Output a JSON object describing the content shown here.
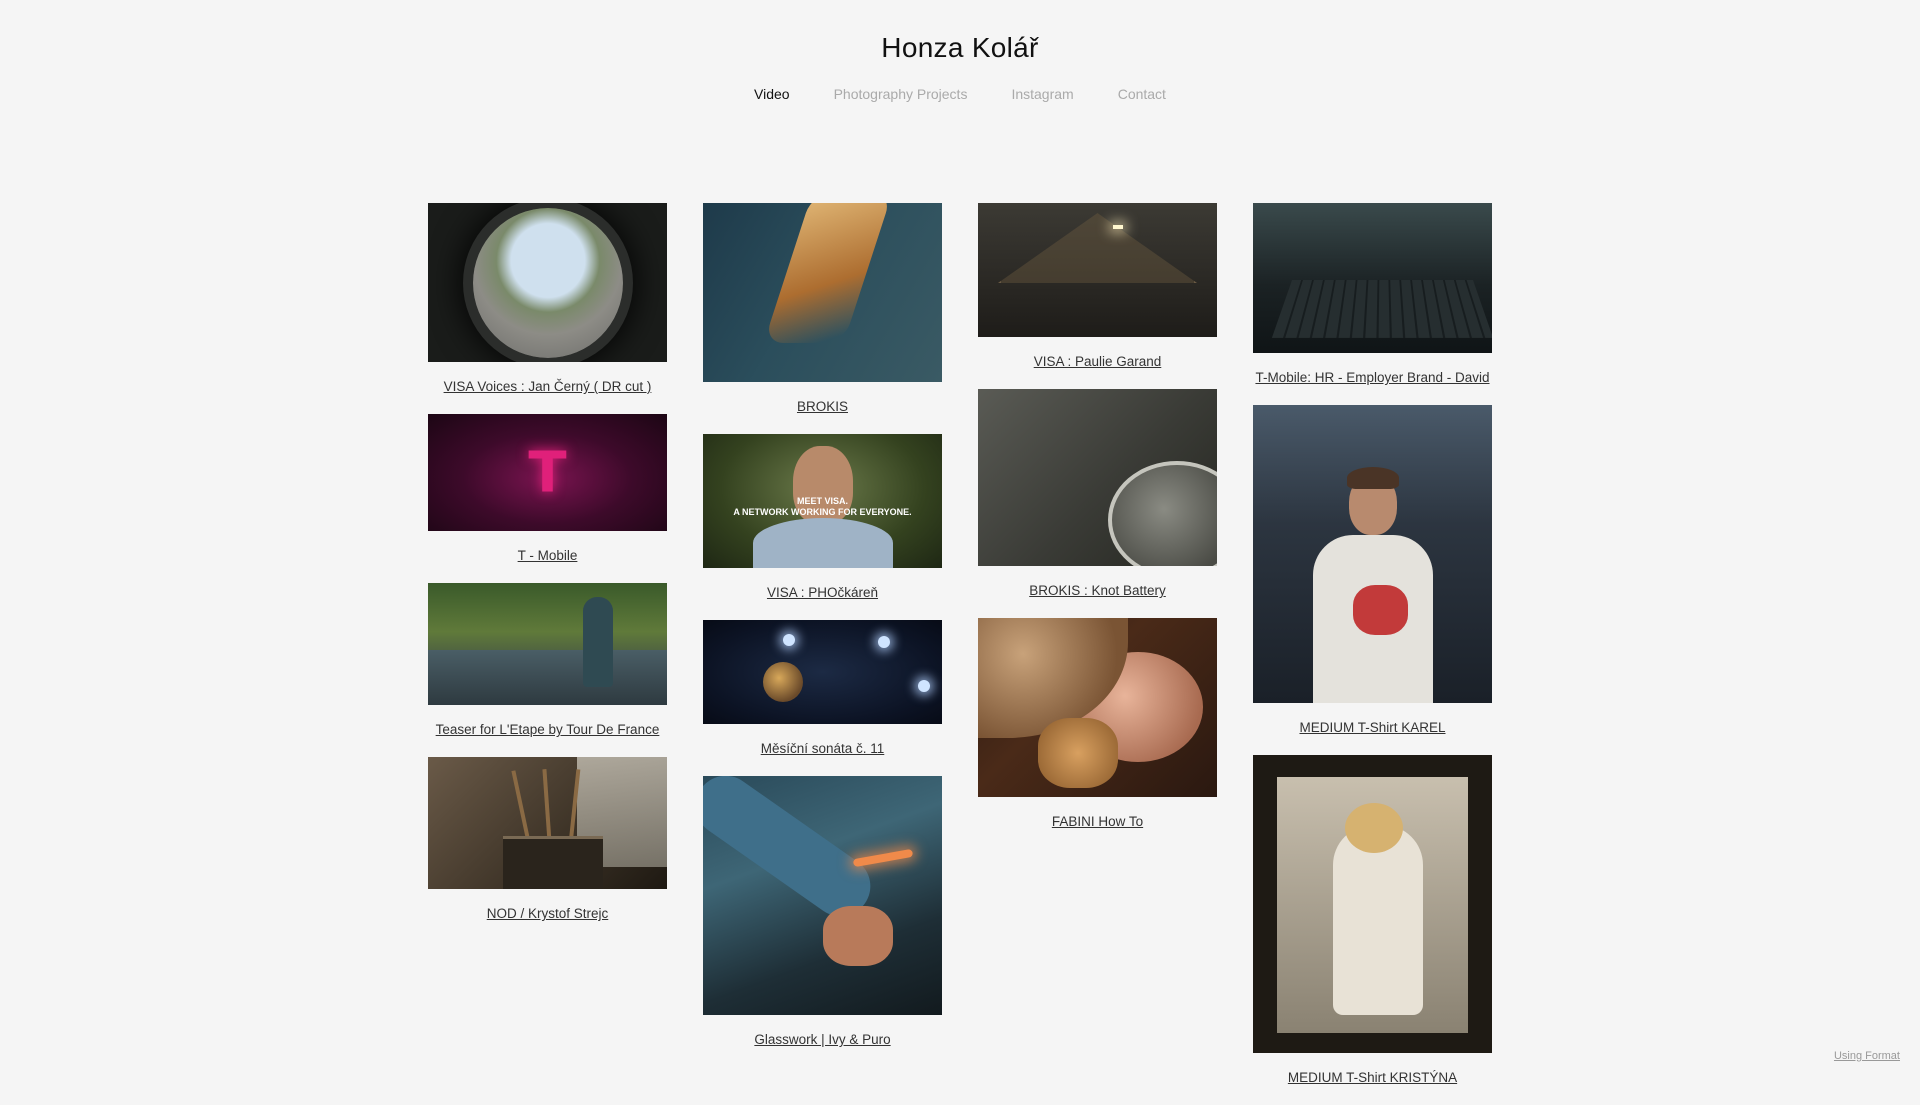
{
  "site": {
    "title": "Honza Kolář"
  },
  "nav": [
    {
      "label": "Video",
      "active": true
    },
    {
      "label": "Photography Projects",
      "active": false
    },
    {
      "label": "Instagram",
      "active": false
    },
    {
      "label": "Contact",
      "active": false
    }
  ],
  "grid": {
    "col1": [
      {
        "caption": "VISA Voices : Jan Černý ( DR cut )"
      },
      {
        "caption": "T - Mobile"
      },
      {
        "caption": "Teaser for L'Etape by Tour De France"
      },
      {
        "caption": "NOD / Krystof Strejc"
      }
    ],
    "col2": [
      {
        "caption": "BROKIS"
      },
      {
        "caption": "VISA : PHOčkáreň",
        "overlay": "MEET VISA.\nA NETWORK WORKING FOR EVERYONE."
      },
      {
        "caption": "Měsíční sonáta č. 11"
      },
      {
        "caption": "Glasswork | Ivy & Puro"
      }
    ],
    "col3": [
      {
        "caption": "VISA : Paulie Garand"
      },
      {
        "caption": "BROKIS : Knot Battery"
      },
      {
        "caption": "FABINI How To"
      }
    ],
    "col4": [
      {
        "caption": "T-Mobile: HR - Employer Brand - David"
      },
      {
        "caption": "MEDIUM T-Shirt KAREL"
      },
      {
        "caption": "MEDIUM T-Shirt KRISTÝNA"
      }
    ]
  },
  "footer": {
    "badge": "Using Format"
  },
  "colors": {
    "background": "#f5f5f5",
    "active_nav": "#111111",
    "inactive_nav": "#aaaaaa"
  }
}
